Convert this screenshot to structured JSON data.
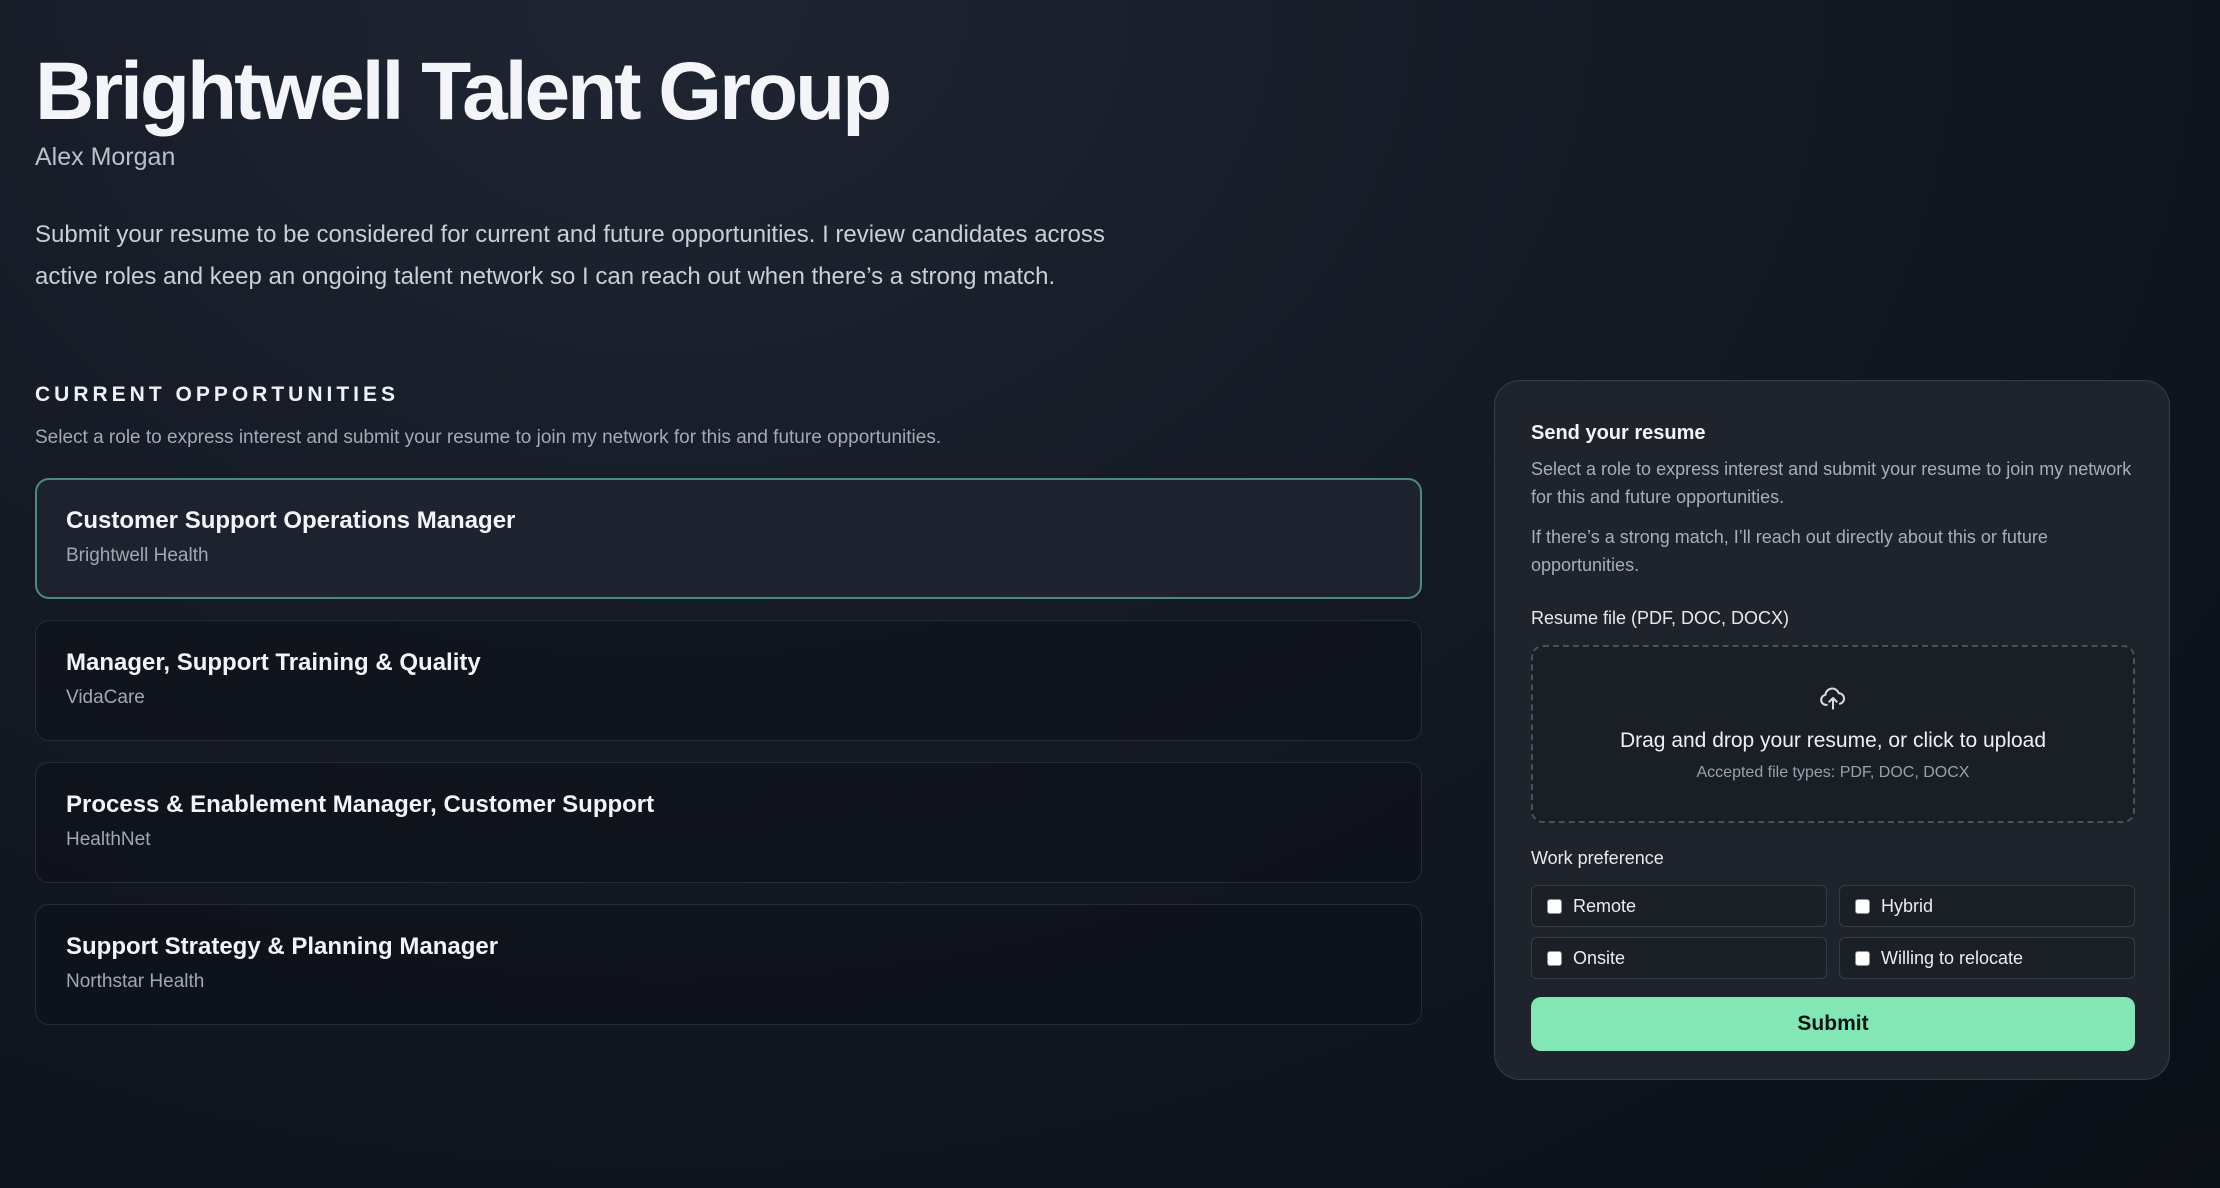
{
  "header": {
    "brand": "Brightwell Talent Group",
    "owner": "Alex Morgan",
    "intro": "Submit your resume to be considered for current and future opportunities. I review candidates across active roles and keep an ongoing talent network so I can reach out when there’s a strong match."
  },
  "opportunities": {
    "title": "CURRENT OPPORTUNITIES",
    "subtitle": "Select a role to express interest and submit your resume to join my network for this and future opportunities.",
    "roles": [
      {
        "title": "Customer Support Operations Manager",
        "company": "Brightwell Health",
        "selected": true
      },
      {
        "title": "Manager, Support Training & Quality",
        "company": "VidaCare",
        "selected": false
      },
      {
        "title": "Process & Enablement Manager, Customer Support",
        "company": "HealthNet",
        "selected": false
      },
      {
        "title": "Support Strategy & Planning Manager",
        "company": "Northstar Health",
        "selected": false
      }
    ]
  },
  "form": {
    "title": "Send your resume",
    "text1": "Select a role to express interest and submit your resume to join my network for this and future opportunities.",
    "text2": "If there’s a strong match, I’ll reach out directly about this or future opportunities.",
    "file_label": "Resume file (PDF, DOC, DOCX)",
    "dropzone_icon": "cloud-upload-icon",
    "dropzone_main": "Drag and drop your resume, or click to upload",
    "dropzone_sub": "Accepted file types: PDF, DOC, DOCX",
    "pref_label": "Work preference",
    "preferences": [
      {
        "label": "Remote",
        "checked": false
      },
      {
        "label": "Hybrid",
        "checked": false
      },
      {
        "label": "Onsite",
        "checked": false
      },
      {
        "label": "Willing to relocate",
        "checked": false
      }
    ],
    "submit_label": "Submit"
  },
  "colors": {
    "accent": "#82e6b5",
    "selected_border": "#4c8a80",
    "background": "#141924",
    "panel": "#1f232b"
  }
}
